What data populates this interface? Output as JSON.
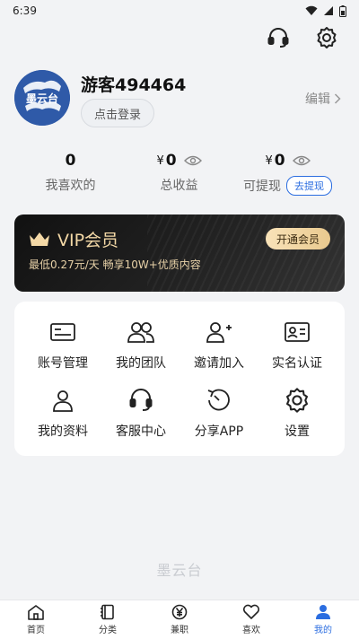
{
  "status_bar": {
    "time": "6:39"
  },
  "profile": {
    "avatar_text": "墨云台",
    "username": "游客494464",
    "login_label": "点击登录",
    "edit_label": "编辑"
  },
  "stats": [
    {
      "value": "0",
      "currency": "",
      "label": "我喜欢的"
    },
    {
      "value": "0",
      "currency": "¥",
      "label": "总收益"
    },
    {
      "value": "0",
      "currency": "¥",
      "label": "可提现",
      "action": "去提现"
    }
  ],
  "vip": {
    "title": "VIP会员",
    "subtitle": "最低0.27元/天 畅享10W+优质内容",
    "button": "开通会员"
  },
  "menu": [
    {
      "label": "账号管理",
      "icon": "id-card-icon"
    },
    {
      "label": "我的团队",
      "icon": "team-icon"
    },
    {
      "label": "邀请加入",
      "icon": "add-user-icon"
    },
    {
      "label": "实名认证",
      "icon": "contact-card-icon"
    },
    {
      "label": "我的资料",
      "icon": "user-icon"
    },
    {
      "label": "客服中心",
      "icon": "headset-icon"
    },
    {
      "label": "分享APP",
      "icon": "share-refresh-icon"
    },
    {
      "label": "设置",
      "icon": "gear-icon"
    }
  ],
  "watermark": "墨云台",
  "nav": [
    {
      "label": "首页",
      "icon": "home-icon"
    },
    {
      "label": "分类",
      "icon": "category-icon"
    },
    {
      "label": "兼职",
      "icon": "yen-icon"
    },
    {
      "label": "喜欢",
      "icon": "heart-icon"
    },
    {
      "label": "我的",
      "icon": "profile-icon"
    }
  ],
  "colors": {
    "accent": "#2b6de0",
    "vip_gold": "#f3d8a6",
    "background": "#f2f3f5"
  }
}
